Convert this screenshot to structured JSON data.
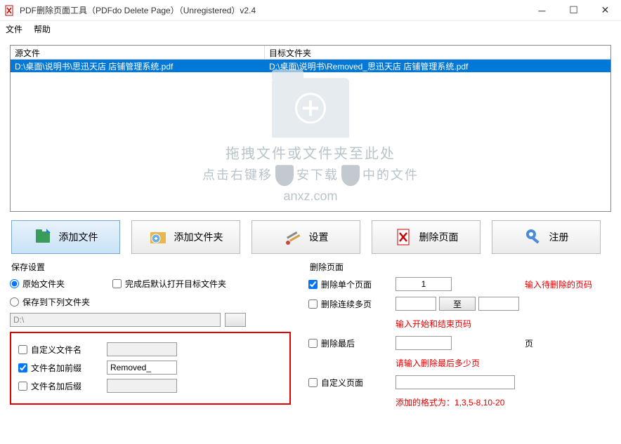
{
  "titlebar": {
    "text": "PDF删除页面工具（PDFdo Delete Page）（Unregistered）v2.4"
  },
  "menu": {
    "file": "文件",
    "help": "帮助"
  },
  "table": {
    "col_source": "源文件",
    "col_target": "目标文件夹",
    "row1_source": "D:\\桌面\\说明书\\思迅天店 店铺管理系统.pdf",
    "row1_target": "D:\\桌面\\说明书\\Removed_思迅天店 店铺管理系统.pdf"
  },
  "watermark": {
    "line1": "拖拽文件或文件夹至此处",
    "line2": "点击右键移除或者移动选中的文件",
    "brand": "anxz.com",
    "brand_cn": "安下载"
  },
  "toolbar": {
    "add_file": "添加文件",
    "add_folder": "添加文件夹",
    "settings": "设置",
    "delete_page": "删除页面",
    "register": "注册"
  },
  "save": {
    "title": "保存设置",
    "orig_folder": "原始文件夹",
    "open_after": "完成后默认打开目标文件夹",
    "save_to": "保存到下列文件夹",
    "path": "D:\\",
    "custom_name": "自定义文件名",
    "prefix": "文件名加前缀",
    "prefix_value": "Removed_",
    "suffix": "文件名加后缀"
  },
  "del": {
    "title": "删除页面",
    "single": "删除单个页面",
    "single_value": "1",
    "single_hint": "输入待删除的页码",
    "multi": "删除连续多页",
    "to": "至",
    "multi_hint": "输入开始和结束页码",
    "last": "删除最后",
    "last_unit": "页",
    "last_hint": "请输入删除最后多少页",
    "custom": "自定义页面",
    "custom_hint": "添加的格式为：1,3,5-8,10-20"
  }
}
